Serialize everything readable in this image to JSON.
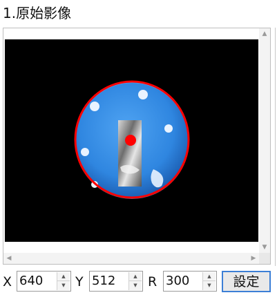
{
  "section_title": "1.原始影像",
  "viewer": {
    "colors": {
      "background": "#000000",
      "fixture_disc": "#3a8fe6",
      "circle_outline": "#ff0000",
      "center_marker": "#ff0000",
      "highlights": "#e9f3ff"
    }
  },
  "controls": {
    "x_label": "X",
    "x_value": "640",
    "y_label": "Y",
    "y_value": "512",
    "r_label": "R",
    "r_value": "300",
    "set_button_label": "設定"
  }
}
